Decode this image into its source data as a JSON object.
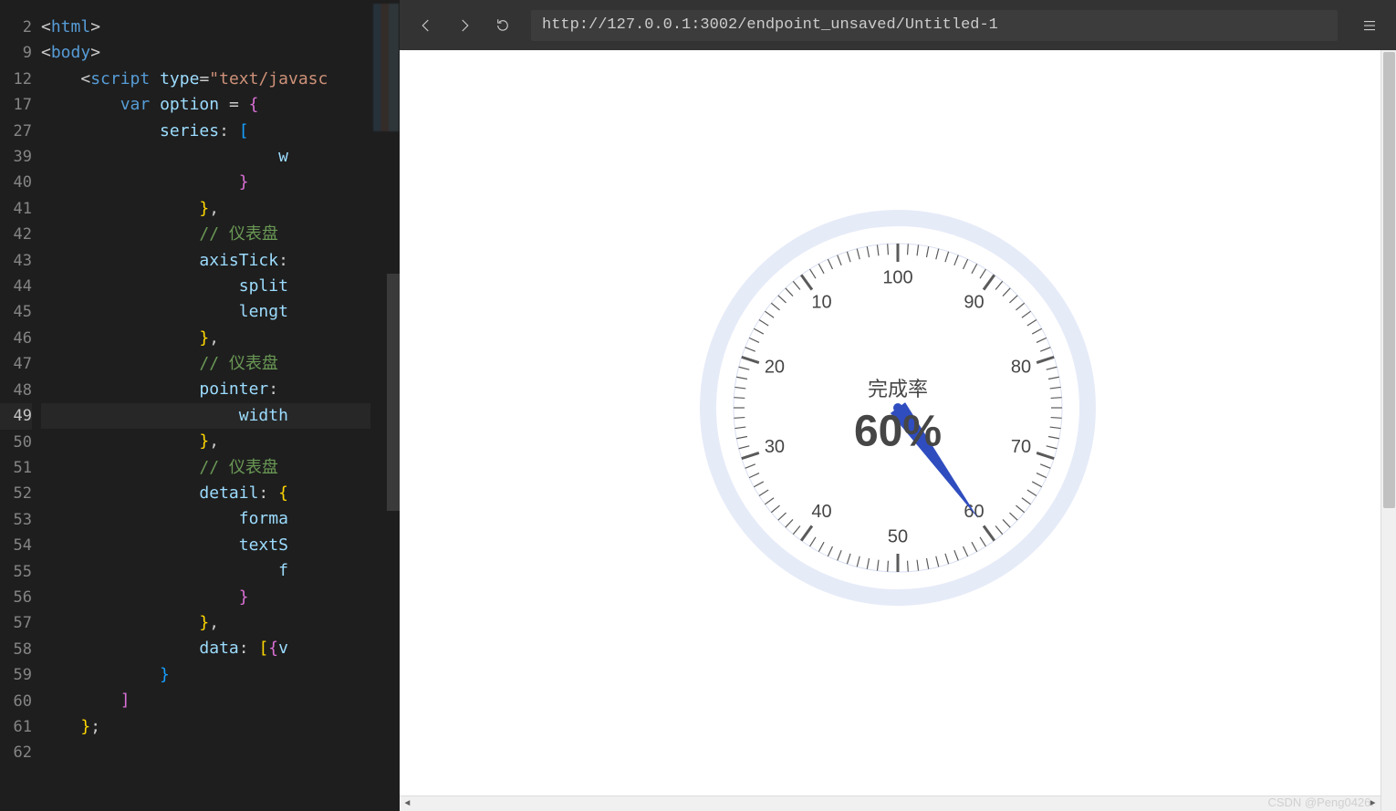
{
  "editor": {
    "line_numbers": [
      "2",
      "9",
      "12",
      "17",
      "27",
      "39",
      "40",
      "41",
      "42",
      "43",
      "44",
      "45",
      "46",
      "47",
      "48",
      "49",
      "50",
      "51",
      "52",
      "53",
      "54",
      "55",
      "56",
      "57",
      "58",
      "59",
      "60",
      "61",
      "62"
    ],
    "current_line_index": 15,
    "lines": {
      "l0": "<html>",
      "l1": "<body>",
      "l2": "    <script type=\"text/javasc",
      "l3": "        var option = {",
      "l4": "            series: [",
      "l5": "                        w",
      "l6": "                    }",
      "l7": "                },",
      "l8": "                // 仪表盘",
      "l9": "                axisTick:",
      "l10": "                    split",
      "l11": "                    lengt",
      "l12": "                },",
      "l13": "                // 仪表盘",
      "l14": "                pointer:",
      "l15": "                    width",
      "l16": "                },",
      "l17": "                // 仪表盘",
      "l18": "                detail: {",
      "l19": "                    forma",
      "l20": "                    textS",
      "l21": "                        f",
      "l22": "                    }",
      "l23": "                },",
      "l24": "                data: [{v",
      "l25": "            }",
      "l26": "        ]",
      "l27": "    };",
      "l28": ""
    }
  },
  "preview": {
    "url": "http://127.0.0.1:3002/endpoint_unsaved/Untitled-1",
    "watermark": "CSDN @Peng0426."
  },
  "chart_data": {
    "type": "gauge",
    "title": "完成率",
    "value": 60,
    "value_display": "60%",
    "min": 0,
    "max": 100,
    "tick_step_major": 10,
    "tick_labels": [
      "10",
      "20",
      "30",
      "40",
      "50",
      "60",
      "70",
      "80",
      "90",
      "100"
    ],
    "pointer_color": "#2f4dbf",
    "ring_color": "#e6ebf8",
    "tick_color": "#5a5a5a"
  }
}
